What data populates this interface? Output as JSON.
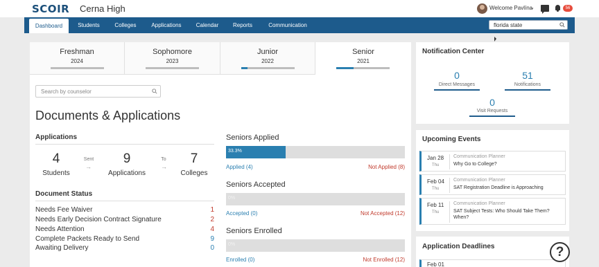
{
  "header": {
    "logo": "SCOIR",
    "school": "Cerna High",
    "welcome": "Welcome Pavlína",
    "badge": "56"
  },
  "nav": {
    "tabs": [
      "Dashboard",
      "Students",
      "Colleges",
      "Applications",
      "Calendar",
      "Reports",
      "Communication"
    ],
    "active": "Dashboard",
    "search_value": "florida state"
  },
  "years": [
    {
      "name": "Freshman",
      "year": "2024",
      "progress": 0
    },
    {
      "name": "Sophomore",
      "year": "2023",
      "progress": 0
    },
    {
      "name": "Junior",
      "year": "2022",
      "progress": 0.12
    },
    {
      "name": "Senior",
      "year": "2021",
      "progress": 0.33
    }
  ],
  "counselor_search_placeholder": "Search by counselor",
  "docs_title": "Documents & Applications",
  "applications": {
    "heading": "Applications",
    "students_count": "4",
    "students_label": "Students",
    "sent_label": "Sent",
    "applications_count": "9",
    "applications_label": "Applications",
    "to_label": "To",
    "colleges_count": "7",
    "colleges_label": "Colleges"
  },
  "document_status": {
    "heading": "Document Status",
    "rows": [
      {
        "label": "Needs Fee Waiver",
        "count": "1",
        "color": "#c0392b"
      },
      {
        "label": "Needs Early Decision Contract Signature",
        "count": "2",
        "color": "#c0392b"
      },
      {
        "label": "Needs Attention",
        "count": "4",
        "color": "#c0392b"
      },
      {
        "label": "Complete Packets Ready to Send",
        "count": "9",
        "color": "#2a7fb0"
      },
      {
        "label": "Awaiting Delivery",
        "count": "0",
        "color": "#2a7fb0"
      }
    ]
  },
  "seniors": [
    {
      "title": "Seniors Applied",
      "percent_text": "33.3%",
      "percent": 33.3,
      "left": "Applied (4)",
      "right": "Not Applied (8)"
    },
    {
      "title": "Seniors Accepted",
      "percent_text": "0%",
      "percent": 0,
      "left": "Accepted (0)",
      "right": "Not Accepted (12)"
    },
    {
      "title": "Seniors Enrolled",
      "percent_text": "0%",
      "percent": 0,
      "left": "Enrolled (0)",
      "right": "Not Enrolled (12)"
    }
  ],
  "notification_center": {
    "title": "Notification Center",
    "direct_messages_count": "0",
    "direct_messages_label": "Direct Messages",
    "notifications_count": "51",
    "notifications_label": "Notifications",
    "visit_requests_count": "0",
    "visit_requests_label": "Visit Requests"
  },
  "upcoming_events": {
    "title": "Upcoming Events",
    "events": [
      {
        "date": "Jan 28",
        "day": "Thu",
        "type": "Communication Planner",
        "title": "Why Go to College?"
      },
      {
        "date": "Feb 04",
        "day": "Thu",
        "type": "Communication Planner",
        "title": "SAT Registration Deadline is Approaching"
      },
      {
        "date": "Feb 11",
        "day": "Thu",
        "type": "Communication Planner",
        "title": "SAT Subject Tests: Who Should Take Them? When?"
      }
    ]
  },
  "application_deadlines": {
    "title": "Application Deadlines",
    "first_date": "Feb 01"
  },
  "help_label": "?",
  "colors": {
    "nav": "#1d5b8c",
    "accent": "#2a7fb0",
    "alert": "#c0392b"
  }
}
